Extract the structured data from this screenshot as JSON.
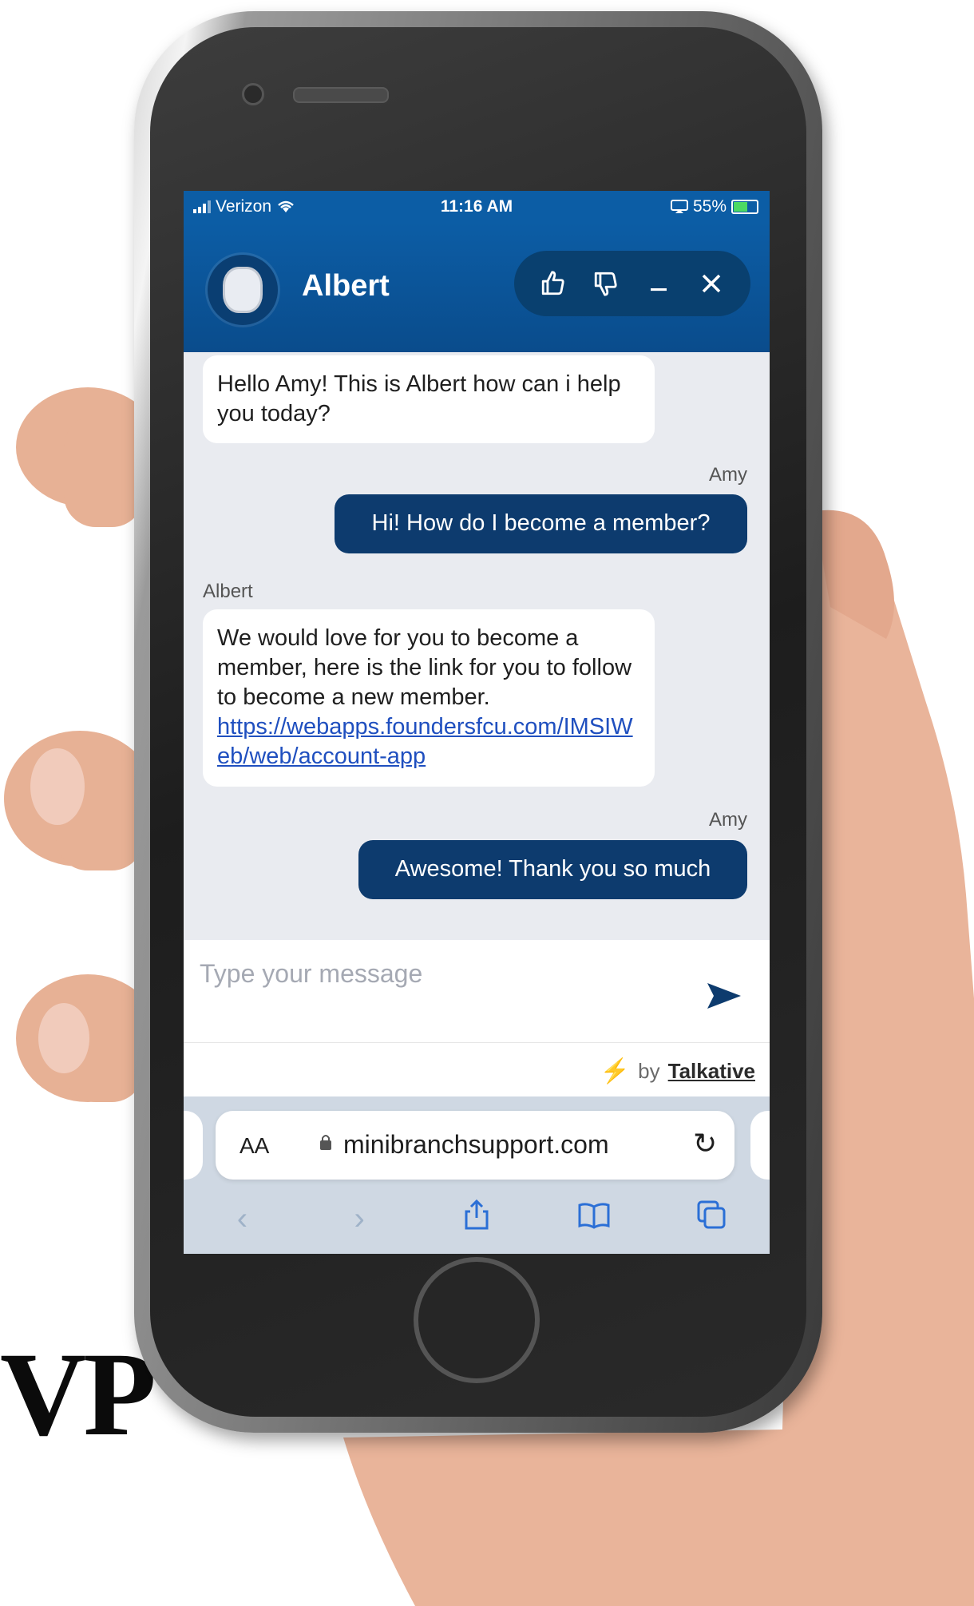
{
  "corner_text": "VP",
  "status_bar": {
    "carrier": "Verizon",
    "time": "11:16 AM",
    "battery": "55%"
  },
  "chat": {
    "agent_name": "Albert",
    "messages": [
      {
        "sender": "",
        "text": "Hello Amy! This is Albert how can i help you today?"
      },
      {
        "sender": "Amy",
        "text": "Hi! How do I become a member?"
      },
      {
        "sender": "Albert",
        "text": "We would love for you to become a member, here is the link for you to follow to become a new member.",
        "link": "https://webapps.foundersfcu.com/IMSIWeb/web/account-app"
      },
      {
        "sender": "Amy",
        "text": "Awesome! Thank you so much"
      }
    ],
    "input_placeholder": "Type your message",
    "powered_by_prefix": "by",
    "powered_by_brand": "Talkative"
  },
  "browser": {
    "text_size_label": "AA",
    "url": "minibranchsupport.com"
  },
  "icons": {
    "thumbs_up": "thumbs-up-icon",
    "thumbs_down": "thumbs-down-icon",
    "minimize": "minimize-icon",
    "close": "close-icon",
    "send": "send-icon",
    "bolt": "lightning-icon",
    "lock": "lock-icon",
    "reload": "reload-icon",
    "back": "back-icon",
    "forward": "forward-icon",
    "share": "share-icon",
    "bookmarks": "bookmarks-icon",
    "tabs": "tabs-icon"
  },
  "colors": {
    "header_blue": "#0c5da5",
    "user_bubble": "#0d3b6e",
    "link": "#1f4fbf",
    "bolt": "#f5b321"
  }
}
